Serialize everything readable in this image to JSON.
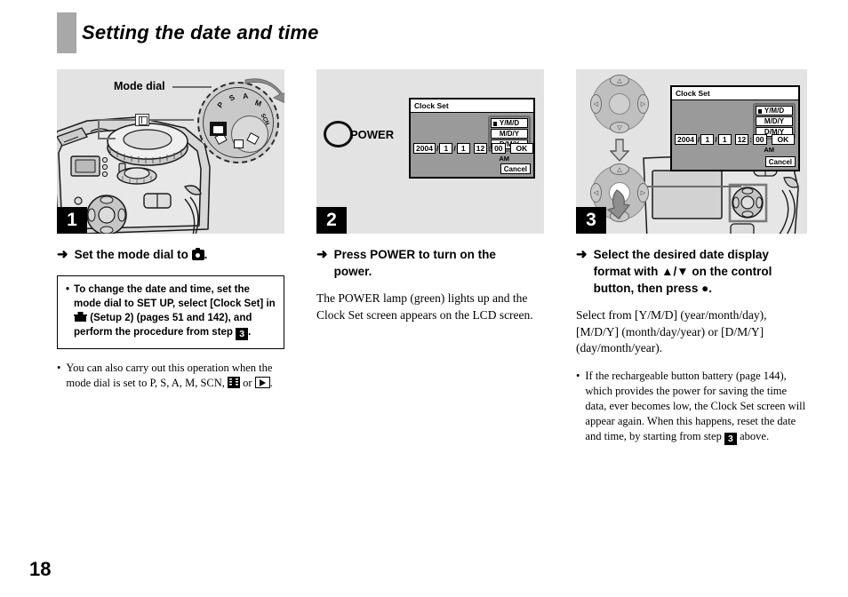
{
  "header": {
    "title": "Setting the date and time"
  },
  "page_number": "18",
  "panel1": {
    "step": "1",
    "mode_dial_label": "Mode dial",
    "dial_ticks": [
      "P",
      "S",
      "A",
      "M",
      "SCN"
    ],
    "instruction_prefix": "Set the mode dial to",
    "instruction_suffix": ".",
    "instruction_icon": "camera-icon",
    "note": {
      "bullet": "•",
      "part1": "To change the date and time, set the mode dial to SET UP, select [Clock Set] in",
      "icon1": "setup-toolbox-icon",
      "part2": "(Setup 2) (pages 51 and 142), and perform the procedure from step",
      "step_ref": "3",
      "part3": "."
    },
    "bullet_note": {
      "bullet": "•",
      "part1": "You can also carry out this operation when the mode dial is set to P, S, A, M, SCN,",
      "icon_film": "film-mode-icon",
      "or_text": "or",
      "icon_play": "playback-icon",
      "part2": "."
    }
  },
  "panel2": {
    "step": "2",
    "power_label": "POWER",
    "instruction_line1": "Press POWER to turn on the",
    "instruction_line2": "power.",
    "body": "The POWER lamp (green) lights up and the Clock Set screen appears on the LCD screen."
  },
  "panel3": {
    "step": "3",
    "instruction_line1": "Select the desired date display",
    "instruction_line2_a": "format with",
    "instruction_line2_up": "▲",
    "instruction_line2_slash": "/",
    "instruction_line2_down": "▼",
    "instruction_line2_b": "on the control",
    "instruction_line3_a": "button, then press",
    "instruction_line3_dot": "●",
    "instruction_line3_b": ".",
    "body": "Select from [Y/M/D] (year/month/day), [M/D/Y] (month/day/year) or [D/M/Y] (day/month/year).",
    "bullet_note": {
      "bullet": "•",
      "part1": "If the rechargeable button battery (page 144), which provides the power for saving the time data, ever becomes low, the Clock Set screen will appear again. When this happens, reset the date and time, by starting from step",
      "step_ref": "3",
      "part2": "above."
    }
  },
  "lcd": {
    "title": "Clock Set",
    "formats": [
      {
        "label": "Y/M/D",
        "selected": true
      },
      {
        "label": "M/D/Y",
        "selected": false
      },
      {
        "label": "D/M/Y",
        "selected": false
      }
    ],
    "year": "2004",
    "sep1": "/",
    "month": "1",
    "sep2": "/",
    "day": "1",
    "hour": "12",
    "sep3": ":",
    "minute": "00",
    "ok_label": "OK",
    "am_label": "AM",
    "cancel_label": "Cancel"
  },
  "colors": {
    "panel_bg": "#e3e3e3",
    "header_bar": "#a8a8a8",
    "lcd_body": "#9a9a9a",
    "badge_bg": "#000000",
    "text": "#000000"
  }
}
